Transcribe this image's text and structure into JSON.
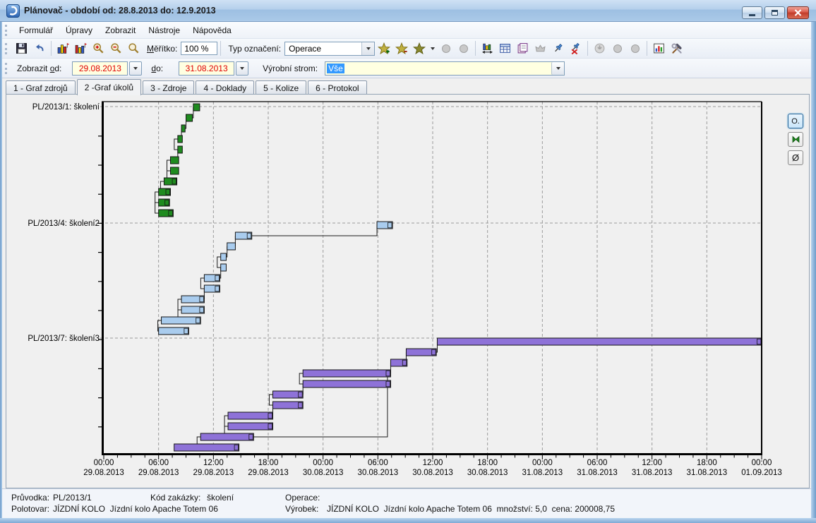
{
  "window": {
    "title": "Plánovač - období od: 28.8.2013 do: 12.9.2013",
    "controls": [
      "minimize",
      "restore",
      "close"
    ]
  },
  "menu": {
    "items": [
      "Formulář",
      "Úpravy",
      "Zobrazit",
      "Nástroje",
      "Nápověda"
    ]
  },
  "toolbar": {
    "scale_label": {
      "key": "M",
      "post": "ěřítko:"
    },
    "scale_value": "100 %",
    "type_label": "Typ označení:",
    "type_value": "Operace",
    "icons": [
      "save-icon",
      "undo-icon",
      "chart-resources-icon",
      "chart-tasks-icon",
      "zoom-in-icon",
      "zoom-out-icon",
      "zoom-icon",
      "select-add-icon",
      "select-remove-icon",
      "select-star-icon",
      "select-dropdown-caret",
      "disabled-circle-icon",
      "disabled-circle-icon-2",
      "fit-chart-icon",
      "table-icon",
      "notes-icon",
      "disabled-crown-icon",
      "pin-icon",
      "unpin-icon",
      "export-disabled-icon",
      "disabled-blob-icon",
      "disabled-blob-icon-2",
      "report-chart-icon",
      "tools-icon"
    ]
  },
  "filterbar": {
    "from_label": {
      "pre": "Zobrazit ",
      "key": "o",
      "post": "d:"
    },
    "from_value": "29.08.2013",
    "to_label": {
      "pre": "",
      "key": "d",
      "post": "o:"
    },
    "to_value": "31.08.2013",
    "tree_label": "Výrobní strom:",
    "tree_value": "Vše"
  },
  "tabs": [
    {
      "label": "1 - Graf zdrojů",
      "active": false
    },
    {
      "label": "2 -Graf úkolů",
      "active": true
    },
    {
      "label": "3 - Zdroje",
      "active": false
    },
    {
      "label": "4 - Doklady",
      "active": false
    },
    {
      "label": "5 - Kolize",
      "active": false
    },
    {
      "label": "6 - Protokol",
      "active": false
    }
  ],
  "side_buttons": [
    {
      "name": "operations-toggle-button",
      "label": "O.",
      "selected": true
    },
    {
      "name": "collapse-button",
      "label": "",
      "selected": false
    },
    {
      "name": "clear-selection-button",
      "label": "Ø",
      "selected": false
    }
  ],
  "status": {
    "pruvodka_label": "Průvodka:",
    "pruvodka_value": "PL/2013/1",
    "kod_label": "Kód zakázky:",
    "kod_value": "školení",
    "operace_label": "Operace:",
    "operace_value": "",
    "polotovar_label": "Polotovar:",
    "polotovar_value": "JÍZDNÍ KOLO  Jízdní kolo Apache Totem 06",
    "vyrobek_label": "Výrobek:",
    "vyrobek_value": "JÍZDNÍ KOLO  Jízdní kolo Apache Totem 06  množství: 5,0  cena: 200008,75"
  },
  "chart_data": {
    "type": "gantt",
    "time_origin": "29.08.2013 00:00",
    "time_end": "01.09.2013 00:00",
    "tick_interval_hours": 6,
    "ticks": [
      {
        "time": "00:00",
        "date": "29.08.2013"
      },
      {
        "time": "06:00",
        "date": "29.08.2013"
      },
      {
        "time": "12:00",
        "date": "29.08.2013"
      },
      {
        "time": "18:00",
        "date": "29.08.2013"
      },
      {
        "time": "00:00",
        "date": "30.08.2013"
      },
      {
        "time": "06:00",
        "date": "30.08.2013"
      },
      {
        "time": "12:00",
        "date": "30.08.2013"
      },
      {
        "time": "18:00",
        "date": "30.08.2013"
      },
      {
        "time": "00:00",
        "date": "31.08.2013"
      },
      {
        "time": "06:00",
        "date": "31.08.2013"
      },
      {
        "time": "12:00",
        "date": "31.08.2013"
      },
      {
        "time": "18:00",
        "date": "31.08.2013"
      },
      {
        "time": "00:00",
        "date": "01.09.2013"
      }
    ],
    "rows": [
      {
        "label": "PL/2013/1: školení",
        "color": "#1F8B1F",
        "tasks": [
          [
            9.8,
            10.5
          ],
          [
            9.0,
            9.7
          ],
          [
            8.5,
            8.9
          ],
          [
            8.1,
            8.6
          ],
          [
            8.1,
            8.6
          ],
          [
            7.3,
            8.2
          ],
          [
            7.3,
            8.2
          ],
          [
            6.6,
            8.0
          ],
          [
            6.0,
            7.3
          ],
          [
            6.0,
            7.2
          ],
          [
            6.0,
            7.6
          ]
        ]
      },
      {
        "label": "PL/2013/4: školení2",
        "color": "#A9CCEE",
        "tasks": [
          [
            29.9,
            31.6
          ],
          [
            14.4,
            16.2
          ],
          [
            13.5,
            14.4
          ],
          [
            12.8,
            13.4
          ],
          [
            12.8,
            13.4
          ],
          [
            11.0,
            12.7
          ],
          [
            11.0,
            12.7
          ],
          [
            8.5,
            11.0
          ],
          [
            8.5,
            11.0
          ],
          [
            6.3,
            10.6
          ],
          [
            6.0,
            9.3
          ]
        ]
      },
      {
        "label": "PL/2013/7: školení3",
        "color": "#8E72D8",
        "tasks": [
          [
            36.5,
            72.0
          ],
          [
            33.1,
            36.4
          ],
          [
            31.4,
            33.2
          ],
          [
            21.8,
            31.4
          ],
          [
            21.8,
            31.4
          ],
          [
            18.5,
            21.8
          ],
          [
            18.5,
            21.8
          ],
          [
            13.6,
            18.5
          ],
          [
            13.6,
            18.5
          ],
          [
            10.6,
            16.4
          ],
          [
            7.7,
            14.8
          ]
        ]
      }
    ],
    "extra_connectors": [
      {
        "group": 2,
        "points": [
          [
            16.4,
            9
          ],
          [
            31.05,
            9
          ],
          [
            31.05,
            3
          ],
          [
            31.4,
            3
          ]
        ]
      },
      {
        "group": 2,
        "points": [
          [
            31.05,
            4
          ],
          [
            31.4,
            4
          ]
        ]
      }
    ]
  }
}
